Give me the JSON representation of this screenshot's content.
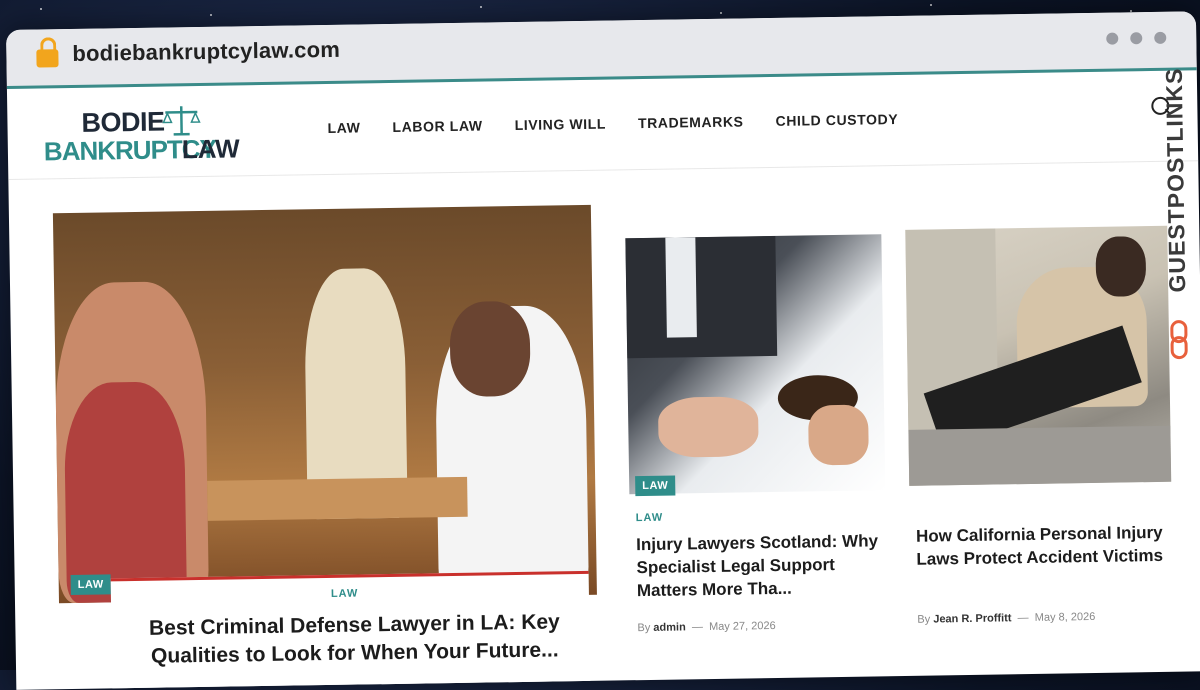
{
  "browser": {
    "url": "bodiebankruptcylaw.com"
  },
  "logo": {
    "line1": "BODIE",
    "line2": "BANKRUPTCY",
    "line3": "LAW"
  },
  "nav": {
    "items": [
      "LAW",
      "LABOR LAW",
      "LIVING WILL",
      "TRADEMARKS",
      "CHILD CUSTODY"
    ]
  },
  "watermark": {
    "text": "GUESTPOSTLINKS"
  },
  "featured": {
    "badge": "LAW",
    "category": "LAW",
    "title": "Best Criminal Defense Lawyer in LA: Key Qualities to Look for When Your Future..."
  },
  "articles": [
    {
      "badge": "LAW",
      "category": "LAW",
      "title": "Injury Lawyers Scotland: Why Specialist Legal Support Matters More Tha...",
      "by": "By",
      "author": "admin",
      "date": "May 27, 2026"
    },
    {
      "title": "How California Personal Injury Laws Protect Accident Victims",
      "by": "By",
      "author": "Jean R. Proffitt",
      "date": "May 8, 2026"
    }
  ],
  "colors": {
    "accent": "#2f8d8a",
    "featured_bar": "#c9302c",
    "lock": "#f2a51d"
  }
}
